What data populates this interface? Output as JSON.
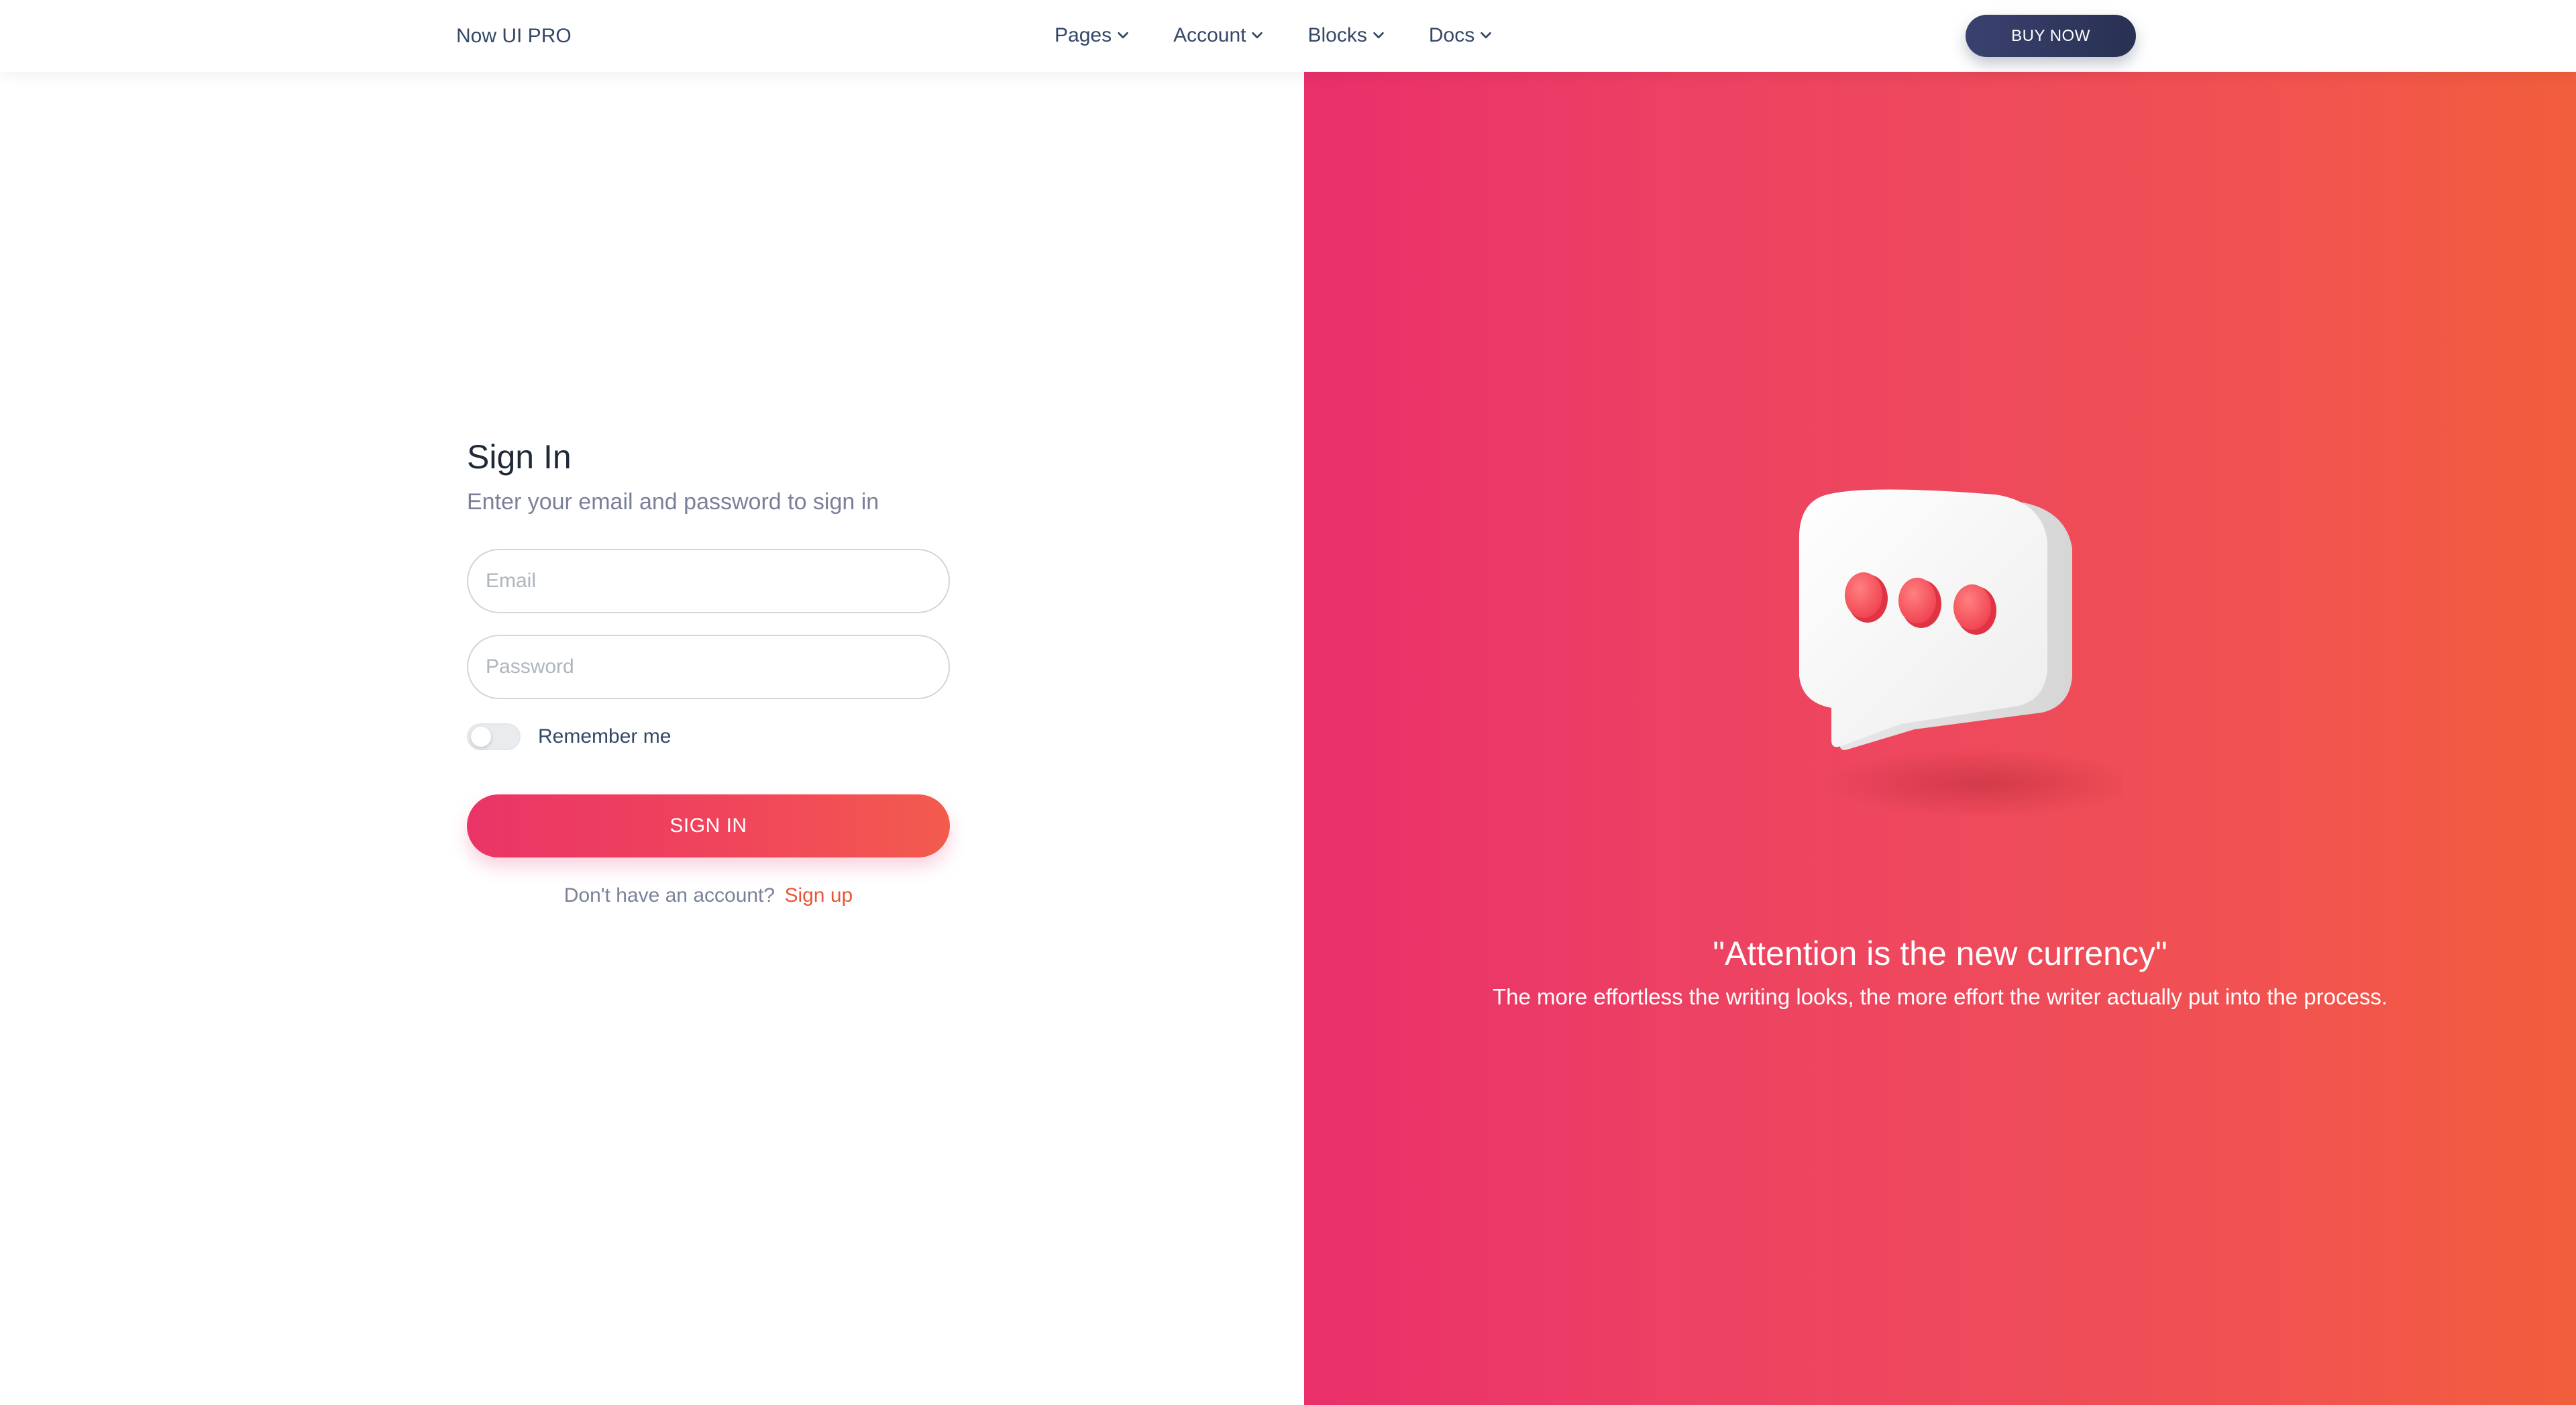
{
  "navbar": {
    "brand": "Now UI PRO",
    "items": [
      {
        "label": "Pages"
      },
      {
        "label": "Account"
      },
      {
        "label": "Blocks"
      },
      {
        "label": "Docs"
      }
    ],
    "cta_label": "BUY NOW"
  },
  "signin": {
    "title": "Sign In",
    "subtitle": "Enter your email and password to sign in",
    "email_placeholder": "Email",
    "password_placeholder": "Password",
    "remember_label": "Remember me",
    "remember_checked": false,
    "submit_label": "SIGN IN",
    "signup_prompt": "Don't have an account?",
    "signup_link": "Sign up"
  },
  "hero": {
    "quote_title": "\"Attention is the new currency\"",
    "quote_text": "The more effortless the writing looks, the more effort the writer actually put into the process.",
    "illustration": "chat-bubble-icon"
  },
  "colors": {
    "brand_dark": "#344767",
    "accent_gradient_start": "#ea2f6b",
    "accent_gradient_end": "#f15e3c",
    "link_orange": "#e8563a",
    "button_dark": "#3a416f"
  }
}
